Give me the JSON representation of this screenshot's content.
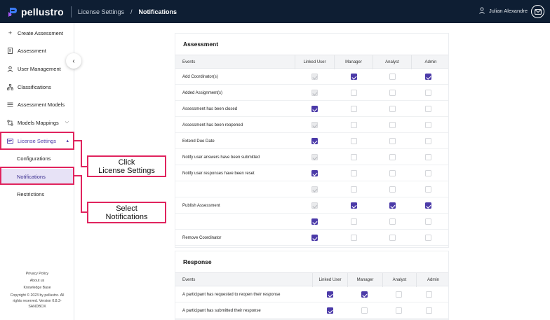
{
  "header": {
    "brand": "pellustro",
    "breadcrumb_parent": "License Settings",
    "breadcrumb_separator": "/",
    "breadcrumb_current": "Notifications",
    "user_name": "Julian Alexandre",
    "bar_color": "#0e1e33"
  },
  "sidebar": {
    "items": [
      {
        "label": "Create Assessment",
        "icon": "plus-icon"
      },
      {
        "label": "Assessment",
        "icon": "document-icon"
      },
      {
        "label": "User Management",
        "icon": "user-icon"
      },
      {
        "label": "Classifications",
        "icon": "hierarchy-icon"
      },
      {
        "label": "Assessment Models",
        "icon": "list-icon"
      },
      {
        "label": "Models Mappings",
        "icon": "mapping-icon"
      },
      {
        "label": "License Settings",
        "icon": "card-icon"
      }
    ],
    "sub_items": [
      "Configurations",
      "Notifications",
      "Restrictions"
    ],
    "footer": {
      "privacy": "Privacy Policy",
      "about": "About us",
      "kb": "Knowledge Base",
      "copyright": "Copyright © 2023 by pellustro. All rights reserved. Version 0.8.3-SANDBOX"
    }
  },
  "annotations": {
    "click_license": [
      "Click",
      "License Settings"
    ],
    "select_notifications": [
      "Select",
      "Notifications"
    ],
    "color": "#e0245e"
  },
  "assessment": {
    "title": "Assessment",
    "columns": [
      "Events",
      "Linked User",
      "Manager",
      "Analyst",
      "Admin"
    ],
    "rows": [
      {
        "event": "Add Coordinator(s)",
        "states": [
          "dis",
          "on",
          "off",
          "on"
        ]
      },
      {
        "event": "Added Assignment(s)",
        "states": [
          "dis",
          "off",
          "off",
          "off"
        ]
      },
      {
        "event": "Assessment has been closed",
        "states": [
          "on",
          "off",
          "off",
          "off"
        ]
      },
      {
        "event": "Assessment has been reopened",
        "states": [
          "dis",
          "off",
          "off",
          "off"
        ]
      },
      {
        "event": "Extend Due Date",
        "states": [
          "on",
          "off",
          "off",
          "off"
        ]
      },
      {
        "event": "Notify user answers have been submitted",
        "states": [
          "dis",
          "off",
          "off",
          "off"
        ]
      },
      {
        "event": "Notify user responses have been reset",
        "states": [
          "on",
          "off",
          "off",
          "off"
        ]
      },
      {
        "event": "",
        "states": [
          "dis",
          "off",
          "off",
          "off"
        ]
      },
      {
        "event": "Publish Assessment",
        "states": [
          "dis",
          "on",
          "on",
          "on"
        ]
      },
      {
        "event": "",
        "states": [
          "on",
          "off",
          "off",
          "off"
        ]
      },
      {
        "event": "Remove Coordinator",
        "states": [
          "on",
          "off",
          "off",
          "off"
        ]
      }
    ]
  },
  "response": {
    "title": "Response",
    "columns": [
      "Events",
      "Linked User",
      "Manager",
      "Analyst",
      "Admin"
    ],
    "rows": [
      {
        "event": "A participant has requested to reopen their response",
        "states": [
          "on",
          "on",
          "off",
          "off"
        ]
      },
      {
        "event": "A participant has submitted their response",
        "states": [
          "on",
          "off",
          "off",
          "off"
        ]
      }
    ]
  }
}
